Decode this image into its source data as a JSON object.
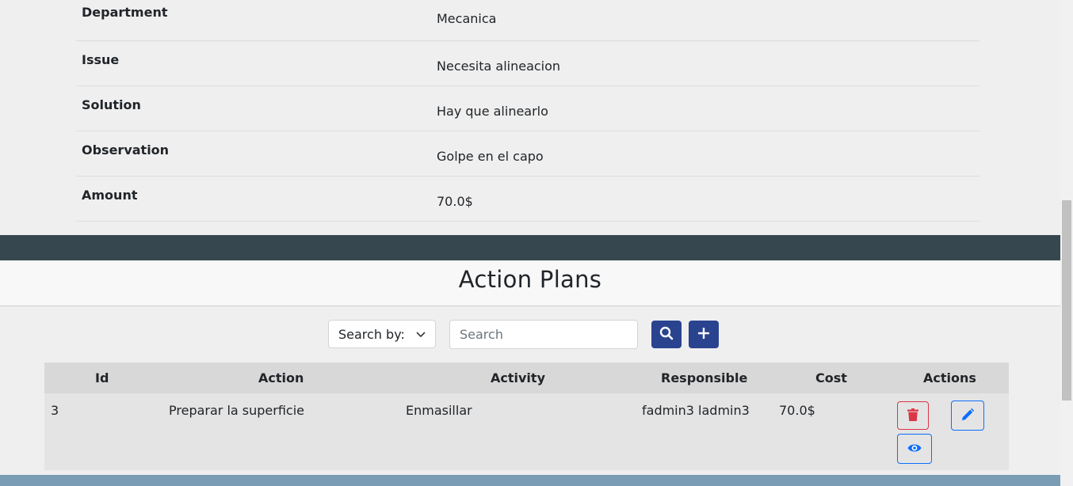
{
  "details": [
    {
      "label": "Department",
      "value": "Mecanica"
    },
    {
      "label": "Issue",
      "value": "Necesita alineacion"
    },
    {
      "label": "Solution",
      "value": "Hay que alinearlo"
    },
    {
      "label": "Observation",
      "value": "Golpe en el capo"
    },
    {
      "label": "Amount",
      "value": "70.0$"
    }
  ],
  "section_title": "Action Plans",
  "search": {
    "select_label": "Search by:",
    "placeholder": "Search"
  },
  "icons": {
    "search_button": "search-icon",
    "add_button": "plus-icon",
    "delete": "trash-icon",
    "edit": "pencil-icon",
    "view": "eye-icon"
  },
  "table": {
    "headers": [
      "Id",
      "Action",
      "Activity",
      "Responsible",
      "Cost",
      "Actions"
    ],
    "rows": [
      {
        "id": "3",
        "action": "Preparar la superficie",
        "activity": "Enmasillar",
        "responsible": "fadmin3 ladmin3",
        "cost": "70.0$"
      }
    ]
  },
  "colors": {
    "primary": "#29438f",
    "danger": "#dc3545",
    "info": "#0d6efd",
    "band": "#36474f"
  }
}
